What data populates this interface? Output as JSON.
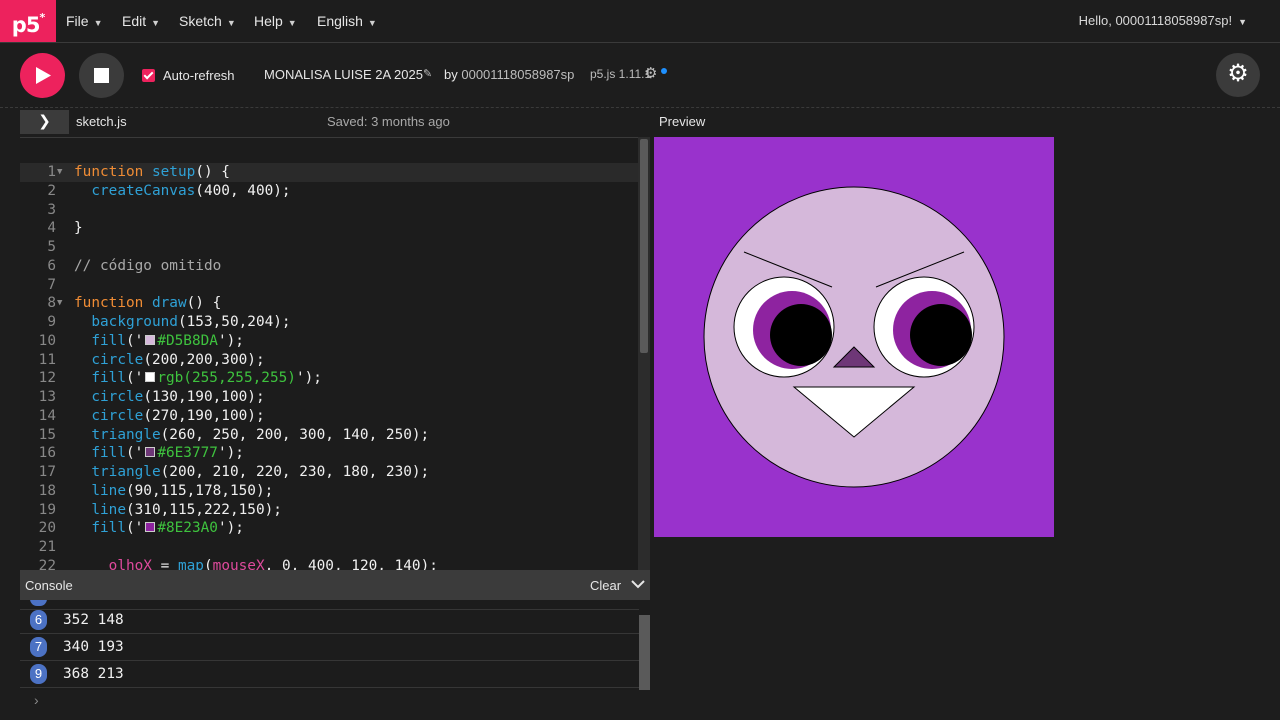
{
  "app": {
    "logo": "p5",
    "logo_star": "*"
  },
  "nav": {
    "menus": [
      {
        "label": "File"
      },
      {
        "label": "Edit"
      },
      {
        "label": "Sketch"
      },
      {
        "label": "Help"
      },
      {
        "label": "English"
      }
    ],
    "user_greeting": "Hello, 00001118058987sp!"
  },
  "toolbar": {
    "auto_refresh_label": "Auto-refresh",
    "auto_refresh_checked": true,
    "sketch_name": "MONALISA LUISE 2A 2025",
    "by_label": "by",
    "author": "00001118058987sp",
    "version": "p5.js 1.11.1",
    "accent_color": "#ed225d"
  },
  "editor": {
    "file_name": "sketch.js",
    "saved_status": "Saved: 3 months ago",
    "active_line": 1,
    "lines": [
      {
        "n": "1",
        "fold": true
      },
      {
        "n": "2"
      },
      {
        "n": "3"
      },
      {
        "n": "4"
      },
      {
        "n": "5"
      },
      {
        "n": "6"
      },
      {
        "n": "7"
      },
      {
        "n": "8",
        "fold": true
      },
      {
        "n": "9"
      },
      {
        "n": "10"
      },
      {
        "n": "11"
      },
      {
        "n": "12"
      },
      {
        "n": "13"
      },
      {
        "n": "14"
      },
      {
        "n": "15"
      },
      {
        "n": "16"
      },
      {
        "n": "17"
      },
      {
        "n": "18"
      },
      {
        "n": "19"
      },
      {
        "n": "20"
      },
      {
        "n": "21"
      },
      {
        "n": "22"
      }
    ],
    "code": {
      "l1": {
        "kw": "function",
        "fn": "setup",
        "rest": "() {"
      },
      "l2": {
        "fn": "createCanvas",
        "rest": "(400, 400);"
      },
      "l4": {
        "rest": "}"
      },
      "l6": {
        "cm": "// código omitido"
      },
      "l8": {
        "kw": "function",
        "fn": "draw",
        "rest": "() {"
      },
      "l9": {
        "fn": "background",
        "rest": "(153,50,204);"
      },
      "l10": {
        "fn": "fill",
        "q1": "('",
        "swatch": "#D5B8DA",
        "str": "#D5B8DA",
        "q2": "');"
      },
      "l11": {
        "fn": "circle",
        "rest": "(200,200,300);"
      },
      "l12": {
        "fn": "fill",
        "q1": "('",
        "swatch": "#ffffff",
        "str": "rgb(255,255,255)",
        "q2": "');"
      },
      "l13": {
        "fn": "circle",
        "rest": "(130,190,100);"
      },
      "l14": {
        "fn": "circle",
        "rest": "(270,190,100);"
      },
      "l15": {
        "fn": "triangle",
        "rest": "(260, 250, 200, 300, 140, 250);"
      },
      "l16": {
        "fn": "fill",
        "q1": "('",
        "swatch": "#6E3777",
        "str": "#6E3777",
        "q2": "');"
      },
      "l17": {
        "fn": "triangle",
        "rest": "(200, 210, 220, 230, 180, 230);"
      },
      "l18": {
        "fn": "line",
        "rest": "(90,115,178,150);"
      },
      "l19": {
        "fn": "line",
        "rest": "(310,115,222,150);"
      },
      "l20": {
        "fn": "fill",
        "q1": "('",
        "swatch": "#8E23A0",
        "str": "#8E23A0",
        "q2": "');"
      },
      "l22": {
        "var1": "olhoX",
        "eq": " = ",
        "fn": "map",
        "open": "(",
        "var2": "mouseX",
        "rest": ", 0, 400, 120, 140);"
      }
    }
  },
  "console": {
    "title": "Console",
    "clear_label": "Clear",
    "entries": [
      {
        "count": "6",
        "text": "352 148"
      },
      {
        "count": "7",
        "text": "340 193"
      },
      {
        "count": "9",
        "text": "368 213"
      }
    ],
    "prompt": "›"
  },
  "preview": {
    "label": "Preview",
    "background": "#9932cc",
    "face_fill": "#D5B8DA",
    "nose_fill": "#6E3777",
    "iris_fill": "#8E23A0",
    "pupil_fill": "#000000"
  }
}
